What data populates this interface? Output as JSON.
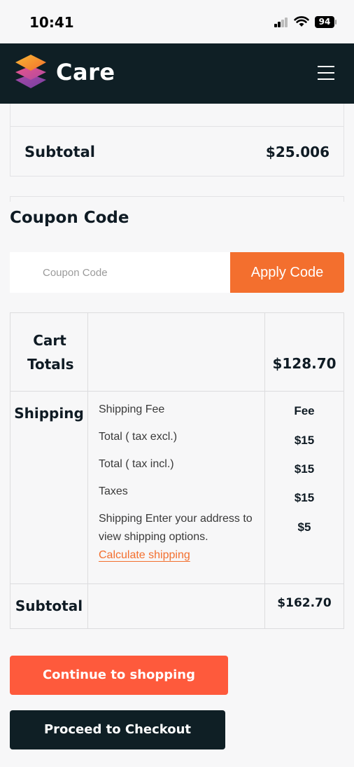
{
  "status": {
    "time": "10:41",
    "battery": "94"
  },
  "header": {
    "brand": "Care"
  },
  "cart_summary": {
    "subtotal_label": "Subtotal",
    "subtotal_value": "$25.006"
  },
  "coupon": {
    "title": "Coupon Code",
    "placeholder": "Coupon Code",
    "apply_label": "Apply Code"
  },
  "totals": {
    "cart_totals_label": "Cart Totals",
    "cart_totals_value": "$128.70",
    "shipping_label": "Shipping",
    "shipping_rows": [
      {
        "label": "Shipping Fee",
        "value": "Fee"
      },
      {
        "label": "Total ( tax excl.)",
        "value": "$15"
      },
      {
        "label": "Total ( tax incl.)",
        "value": "$15"
      },
      {
        "label": "Taxes",
        "value": "$15"
      },
      {
        "label": "Shipping Enter your address to view shipping options.",
        "value": "$5"
      }
    ],
    "calculate_link": "Calculate shipping",
    "subtotal_label": "Subtotal",
    "subtotal_value": "$162.70"
  },
  "actions": {
    "continue_label": "Continue to shopping",
    "checkout_label": "Proceed to Checkout"
  },
  "colors": {
    "accent": "#f36f2e",
    "continue": "#fe5a3c",
    "dark": "#0f1f25"
  }
}
